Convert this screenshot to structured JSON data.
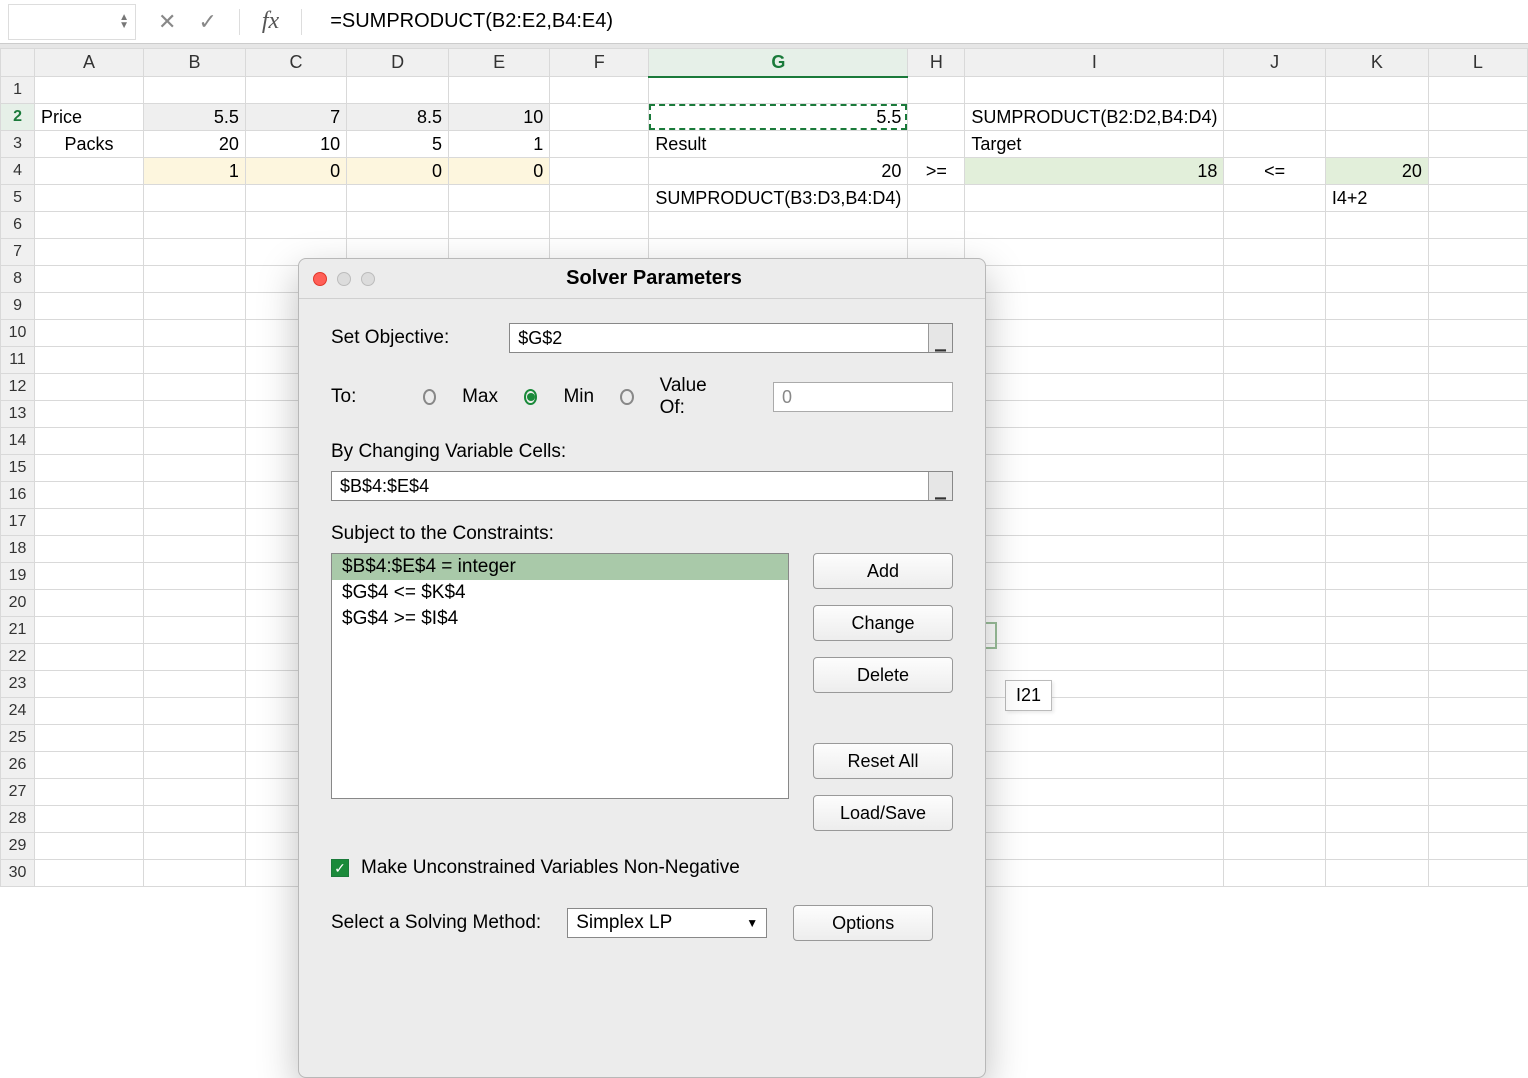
{
  "formula_bar": {
    "name_box": "",
    "formula": "=SUMPRODUCT(B2:E2,B4:E4)"
  },
  "columns": [
    "A",
    "B",
    "C",
    "D",
    "E",
    "F",
    "G",
    "H",
    "I",
    "J",
    "K",
    "L"
  ],
  "rows_count": 30,
  "active_col": "G",
  "active_row": 2,
  "cells": {
    "A2": "Price",
    "B2": "5.5",
    "C2": "7",
    "D2": "8.5",
    "E2": "10",
    "G2": "5.5",
    "I2": "SUMPRODUCT(B2:D2,B4:D4)",
    "A3": "Packs",
    "B3": "20",
    "C3": "10",
    "D3": "5",
    "E3": "1",
    "G3": "Result",
    "I3": "Target",
    "B4": "1",
    "C4": "0",
    "D4": "0",
    "E4": "0",
    "G4": "20",
    "H4": ">=",
    "I4": "18",
    "J4": "<=",
    "K4": "20",
    "G5": "SUMPRODUCT(B3:D3,B4:D4)",
    "K5": "I4+2"
  },
  "dialog": {
    "title": "Solver Parameters",
    "set_objective_label": "Set Objective:",
    "set_objective_value": "$G$2",
    "to_label": "To:",
    "opt_max": "Max",
    "opt_min": "Min",
    "opt_valueof": "Value Of:",
    "valueof_value": "0",
    "by_changing_label": "By Changing Variable Cells:",
    "by_changing_value": "$B$4:$E$4",
    "constraints_label": "Subject to the Constraints:",
    "constraints": [
      "$B$4:$E$4 = integer",
      "$G$4 <= $K$4",
      "$G$4 >= $I$4"
    ],
    "btn_add": "Add",
    "btn_change": "Change",
    "btn_delete": "Delete",
    "btn_reset": "Reset All",
    "btn_loadsave": "Load/Save",
    "make_unconstrained": "Make Unconstrained Variables Non-Negative",
    "method_label": "Select a Solving Method:",
    "method_value": "Simplex LP",
    "btn_options": "Options"
  },
  "tooltip": "I21"
}
